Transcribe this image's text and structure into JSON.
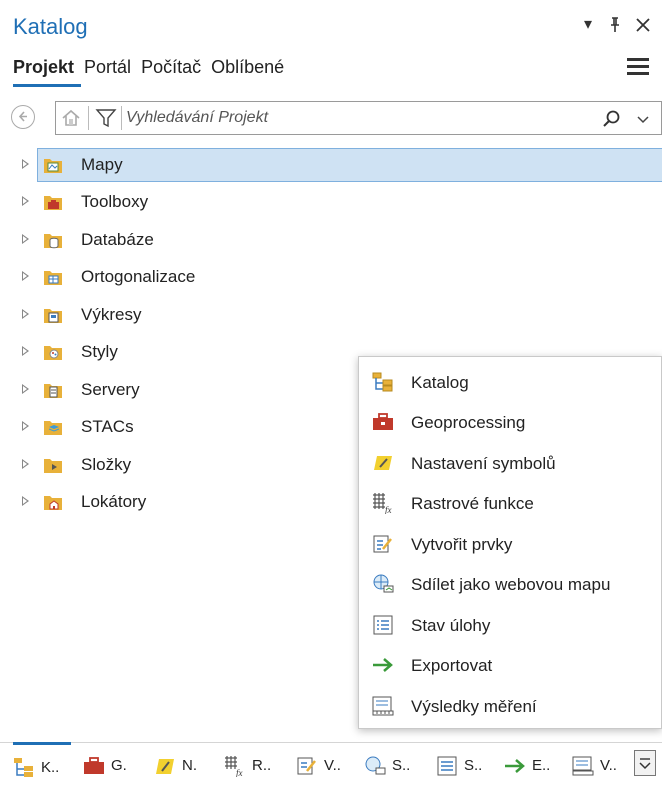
{
  "panel": {
    "title": "Katalog",
    "pin_glyph": "⊣",
    "close_glyph": "✕",
    "dropdown_glyph": "▾"
  },
  "tabs": [
    {
      "label": "Projekt",
      "active": true
    },
    {
      "label": "Portál"
    },
    {
      "label": "Počítač"
    },
    {
      "label": "Oblíbené"
    }
  ],
  "search": {
    "placeholder": "Vyhledávání Projekt"
  },
  "tree": [
    {
      "label": "Mapy",
      "icon": "maps-folder-icon",
      "selected": true
    },
    {
      "label": "Toolboxy",
      "icon": "toolbox-folder-icon"
    },
    {
      "label": "Databáze",
      "icon": "database-folder-icon"
    },
    {
      "label": "Ortogonalizace",
      "icon": "ortho-folder-icon"
    },
    {
      "label": "Výkresy",
      "icon": "layouts-folder-icon"
    },
    {
      "label": "Styly",
      "icon": "styles-folder-icon"
    },
    {
      "label": "Servery",
      "icon": "servers-folder-icon"
    },
    {
      "label": "STACs",
      "icon": "stacs-folder-icon"
    },
    {
      "label": "Složky",
      "icon": "folders-folder-icon"
    },
    {
      "label": "Lokátory",
      "icon": "locators-folder-icon"
    }
  ],
  "popup_menu": [
    {
      "label": "Katalog",
      "icon": "catalog-icon"
    },
    {
      "label": "Geoprocessing",
      "icon": "toolbox-icon"
    },
    {
      "label": "Nastavení symbolů",
      "icon": "symbology-icon"
    },
    {
      "label": "Rastrové funkce",
      "icon": "raster-functions-icon"
    },
    {
      "label": "Vytvořit prvky",
      "icon": "create-features-icon"
    },
    {
      "label": "Sdílet jako webovou mapu",
      "icon": "share-web-map-icon"
    },
    {
      "label": "Stav úlohy",
      "icon": "job-status-icon"
    },
    {
      "label": "Exportovat",
      "icon": "export-arrow-icon"
    },
    {
      "label": "Výsledky měření",
      "icon": "measurement-results-icon"
    }
  ],
  "bottom_tabs": [
    {
      "label": "K..",
      "active": true
    },
    {
      "label": "G."
    },
    {
      "label": "N."
    },
    {
      "label": "R.."
    },
    {
      "label": "V.."
    },
    {
      "label": "S.."
    },
    {
      "label": "S.."
    },
    {
      "label": "E.."
    },
    {
      "label": "V.."
    }
  ],
  "colors": {
    "accent": "#1f6fb5",
    "selection": "#cfe2f3",
    "folder": "#e8b13a"
  }
}
